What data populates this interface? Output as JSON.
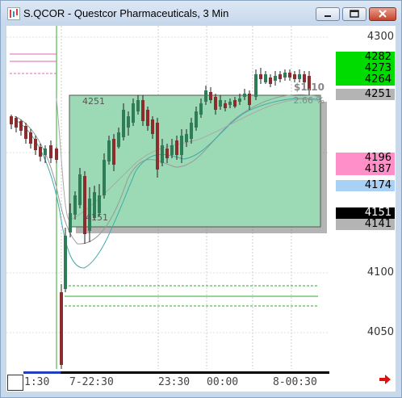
{
  "window": {
    "title": "S.QCOR - Questcor Pharmaceuticals, 3 Min",
    "minimize_icon": "minimize-icon",
    "maximize_icon": "maximize-icon",
    "close_icon": "close-icon"
  },
  "price_axis": {
    "ticks": [
      "4300",
      "4100",
      "4050"
    ]
  },
  "price_markers": [
    {
      "label": "4282",
      "bg": "#00dc00",
      "fg": "#000000"
    },
    {
      "label": "4273",
      "bg": "#00dc00",
      "fg": "#000000"
    },
    {
      "label": "4264",
      "bg": "#00dc00",
      "fg": "#000000"
    },
    {
      "label": "4251",
      "bg": "#b4b4b4",
      "fg": "#000000"
    },
    {
      "label": "4196",
      "bg": "#ff8fc8",
      "fg": "#000000"
    },
    {
      "label": "4187",
      "bg": "#ff8fc8",
      "fg": "#000000"
    },
    {
      "label": "4174",
      "bg": "#a9d0f5",
      "fg": "#000000"
    },
    {
      "label": "4151",
      "bg": "#000000",
      "fg": "#ffffff"
    },
    {
      "label": "4141",
      "bg": "#b4b4b4",
      "fg": "#000000"
    }
  ],
  "chart_overlay": {
    "range_top_label": "4251",
    "range_bottom_label": "4151",
    "change_value": "$1.10",
    "change_percent": "2.66 %",
    "box_color": "#9bdab4"
  },
  "time_axis": {
    "labels": [
      "1:30",
      "7-22:30",
      "23:30",
      "00:00",
      "8-00:30"
    ]
  },
  "colors": {
    "candle_up": "#2e7d57",
    "candle_down": "#8b2d2d",
    "accent_green": "#00dc00",
    "accent_pink": "#ff8fc8"
  },
  "nav": {
    "scroll_icon": "arrow-right-icon"
  }
}
